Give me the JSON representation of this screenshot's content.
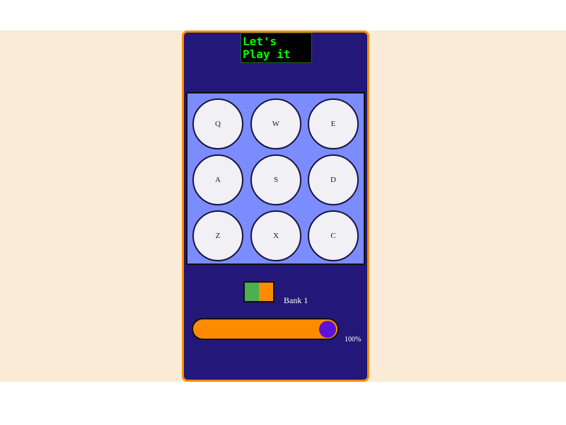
{
  "display": {
    "text": "Let's Play it"
  },
  "pad": {
    "keys": [
      {
        "label": "Q"
      },
      {
        "label": "W"
      },
      {
        "label": "E"
      },
      {
        "label": "A"
      },
      {
        "label": "S"
      },
      {
        "label": "D"
      },
      {
        "label": "Z"
      },
      {
        "label": "X"
      },
      {
        "label": "C"
      }
    ]
  },
  "bank": {
    "label": "Bank 1",
    "colors": {
      "left": "#4caf50",
      "right": "#ff8c00"
    }
  },
  "volume": {
    "label": "100%",
    "value": 1.0
  },
  "colors": {
    "background": "#faebd7",
    "machine": "#23187a",
    "machine_border": "#ff8c00",
    "pad": "#7b8cff",
    "display_text": "#00ff00",
    "slider_track": "#ff8c00",
    "slider_thumb": "#5b12d6"
  }
}
